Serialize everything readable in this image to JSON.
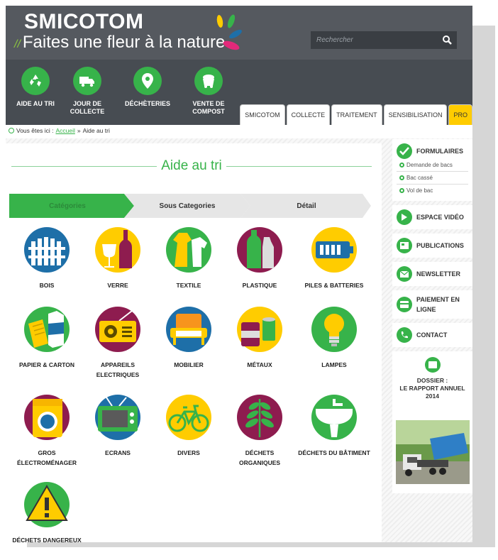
{
  "header": {
    "brand": "SMICOTOM",
    "tagline": "Faites une fleur à la nature",
    "search_placeholder": "Rechercher"
  },
  "quick_links": [
    {
      "label": "AIDE AU TRI",
      "icon": "recycle-icon"
    },
    {
      "label": "JOUR DE COLLECTE",
      "icon": "truck-icon"
    },
    {
      "label": "DÉCHÈTERIES",
      "icon": "location-pin-icon"
    },
    {
      "label": "VENTE DE COMPOST",
      "icon": "compost-icon"
    }
  ],
  "tabs": [
    "SMICOTOM",
    "COLLECTE",
    "TRAITEMENT",
    "SENSIBILISATION",
    "PRO"
  ],
  "breadcrumb": {
    "prefix": "Vous êtes ici :",
    "home": "Accueil",
    "separator": "»",
    "current": "Aide au tri"
  },
  "page_title": "Aide au tri",
  "steps": [
    "Catégories",
    "Sous Categories",
    "Détail"
  ],
  "categories": [
    {
      "name": "BOIS"
    },
    {
      "name": "VERRE"
    },
    {
      "name": "TEXTILE"
    },
    {
      "name": "PLASTIQUE"
    },
    {
      "name": "PILES & BATTERIES"
    },
    {
      "name": "PAPIER & CARTON"
    },
    {
      "name": "APPAREILS ELECTRIQUES"
    },
    {
      "name": "MOBILIER"
    },
    {
      "name": "MÉTAUX"
    },
    {
      "name": "LAMPES"
    },
    {
      "name": "GROS ÉLECTROMÉNAGER"
    },
    {
      "name": "ECRANS"
    },
    {
      "name": "DIVERS"
    },
    {
      "name": "DÉCHETS ORGANIQUES"
    },
    {
      "name": "DÉCHETS DU BÂTIMENT"
    },
    {
      "name": "DÉCHETS DANGEREUX"
    }
  ],
  "sidebar": {
    "formulaires": {
      "title": "FORMULAIRES",
      "links": [
        "Demande de bacs",
        "Bac cassé",
        "Vol de bac"
      ]
    },
    "items": [
      "ESPACE VIDÉO",
      "PUBLICATIONS",
      "NEWSLETTER",
      "PAIEMENT EN LIGNE",
      "CONTACT"
    ],
    "dossier": {
      "line1": "DOSSIER :",
      "line2": "LE RAPPORT ANNUEL",
      "line3": "2014"
    }
  },
  "colors": {
    "green": "#37b34a",
    "dark": "#474c52",
    "yellow": "#ffcc00",
    "maroon": "#8e1c4f",
    "blue": "#1e6fa8"
  }
}
